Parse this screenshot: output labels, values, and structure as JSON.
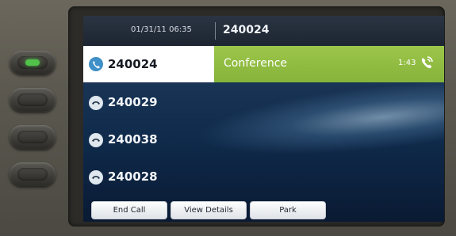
{
  "status": {
    "datetime": "01/31/11 06:35",
    "line": "240024"
  },
  "lines": [
    {
      "number": "240024",
      "icon": "phone-active-icon",
      "session": {
        "label": "Conference",
        "timer": "1:43",
        "icon": "conference-call-icon"
      }
    },
    {
      "number": "240029",
      "icon": "handset-icon"
    },
    {
      "number": "240038",
      "icon": "handset-icon"
    },
    {
      "number": "240028",
      "icon": "handset-icon"
    }
  ],
  "softkeys": [
    "End Call",
    "View Details",
    "Park"
  ],
  "colors": {
    "active_session": "#9cc64a",
    "line_selected_bg": "#ffffff",
    "status_bar": "#1d2532",
    "screen_bg": "#1a3556",
    "led_green": "#52c34a"
  }
}
